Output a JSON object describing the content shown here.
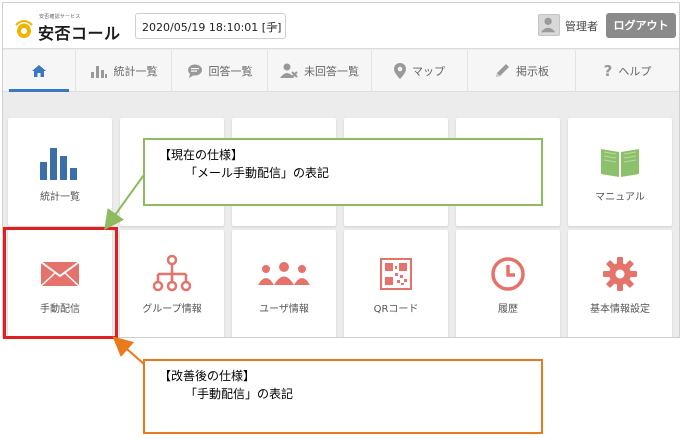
{
  "app": {
    "logo_subtitle": "安否確認サービス",
    "logo_title": "安否コール"
  },
  "header": {
    "datetime": "2020/05/19 18:10:01 [手]",
    "user_name": "管理者",
    "logout_label": "ログアウト"
  },
  "nav": [
    {
      "label": "",
      "icon": "home-icon"
    },
    {
      "label": "統計一覧",
      "icon": "bar-chart-icon"
    },
    {
      "label": "回答一覧",
      "icon": "speech-bubble-icon"
    },
    {
      "label": "未回答一覧",
      "icon": "user-x-icon"
    },
    {
      "label": "マップ",
      "icon": "map-pin-icon"
    },
    {
      "label": "掲示板",
      "icon": "pencil-icon"
    },
    {
      "label": "ヘルプ",
      "icon": "question-icon"
    }
  ],
  "tiles_row1": [
    {
      "label": "統計一覧",
      "icon": "bar-chart-icon"
    },
    {
      "label": "",
      "icon": ""
    },
    {
      "label": "",
      "icon": ""
    },
    {
      "label": "",
      "icon": ""
    },
    {
      "label": "",
      "icon": ""
    },
    {
      "label": "マニュアル",
      "icon": "book-icon"
    }
  ],
  "tiles_row2": [
    {
      "label": "手動配信",
      "icon": "envelope-icon"
    },
    {
      "label": "グループ情報",
      "icon": "hierarchy-icon"
    },
    {
      "label": "ユーザ情報",
      "icon": "users-icon"
    },
    {
      "label": "QRコード",
      "icon": "qr-code-icon"
    },
    {
      "label": "履歴",
      "icon": "clock-icon"
    },
    {
      "label": "基本情報設定",
      "icon": "gear-icon"
    }
  ],
  "annotations": {
    "current": {
      "title": "【現在の仕様】",
      "body": "「メール手動配信」の表記"
    },
    "improved": {
      "title": "【改善後の仕様】",
      "body": "「手動配信」の表記"
    }
  },
  "colors": {
    "accent_blue": "#3a78c2",
    "tile_icon_blue": "#3a6fa8",
    "tile_icon_green": "#8cc06a",
    "tile_icon_red": "#e5736b",
    "current_border": "#8dbb60",
    "improved_border": "#e87a1c",
    "highlight_red": "#e02020"
  }
}
